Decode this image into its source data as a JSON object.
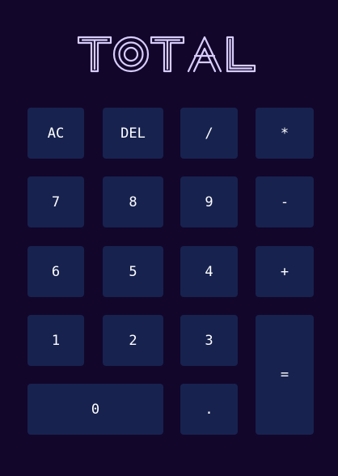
{
  "header": {
    "logo_text": "TOTAL"
  },
  "keys": {
    "ac": "AC",
    "del": "DEL",
    "divide": "/",
    "multiply": "*",
    "seven": "7",
    "eight": "8",
    "nine": "9",
    "minus": "-",
    "six": "6",
    "five": "5",
    "four": "4",
    "plus": "+",
    "one": "1",
    "two": "2",
    "three": "3",
    "equals": "=",
    "zero": "0",
    "decimal": "."
  },
  "colors": {
    "background": "#12062a",
    "key_background": "#17224f",
    "key_text": "#ffffff",
    "logo_outline": "#d8cdfb"
  }
}
